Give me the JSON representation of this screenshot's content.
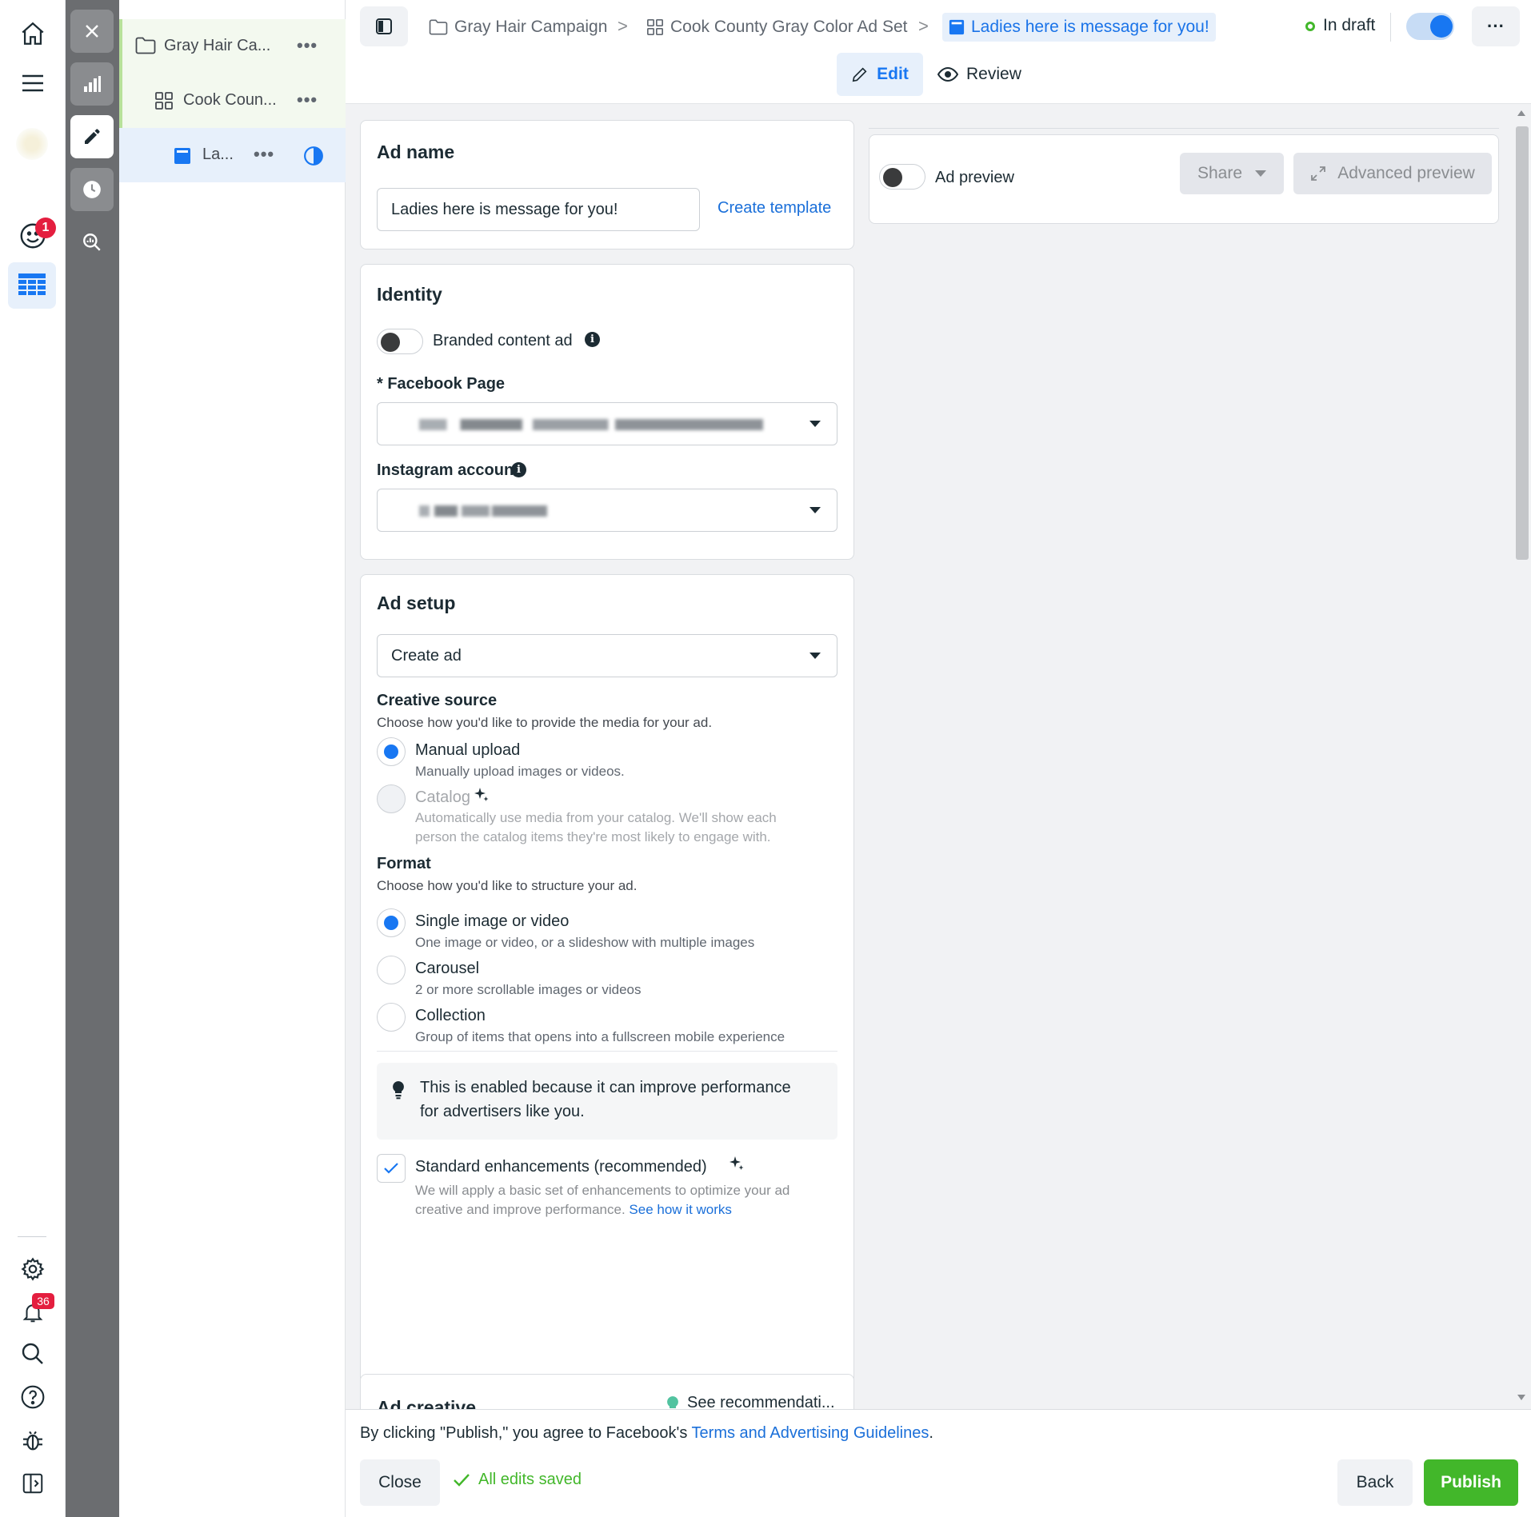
{
  "rail": {
    "notif_badge": "1",
    "alerts_badge": "36"
  },
  "tree": {
    "campaign": "Gray Hair Ca...",
    "adset": "Cook Coun...",
    "ad": "La...",
    "dots": "•••"
  },
  "header": {
    "crumbs": [
      "Gray Hair Campaign",
      "Cook County Gray Color Ad Set",
      "Ladies here is message for you!"
    ],
    "sep": ">",
    "status": "In draft",
    "more": "···",
    "tabs": {
      "edit": "Edit",
      "review": "Review"
    }
  },
  "adname": {
    "title": "Ad name",
    "value": "Ladies here is message for you!",
    "create_template": "Create template"
  },
  "identity": {
    "title": "Identity",
    "branded": "Branded content ad",
    "fb_page_label": "* Facebook Page",
    "ig_label": "Instagram account"
  },
  "setup": {
    "title": "Ad setup",
    "select_value": "Create ad",
    "creative_title": "Creative source",
    "creative_sub": "Choose how you'd like to provide the media for your ad.",
    "manual_label": "Manual upload",
    "manual_desc": "Manually upload images or videos.",
    "catalog_label": "Catalog",
    "catalog_desc1": "Automatically use media from your catalog. We'll show each",
    "catalog_desc2": "person the catalog items they're most likely to engage with.",
    "format_title": "Format",
    "format_sub": "Choose how you'd like to structure your ad.",
    "single_label": "Single image or video",
    "single_desc": "One image or video, or a slideshow with multiple images",
    "carousel_label": "Carousel",
    "carousel_desc": "2 or more scrollable images or videos",
    "collection_label": "Collection",
    "collection_desc": "Group of items that opens into a fullscreen mobile experience",
    "tip1": "This is enabled because it can improve performance",
    "tip2": "for advertisers like you.",
    "enh_label": "Standard enhancements (recommended)",
    "enh_desc1": "We will apply a basic set of enhancements to optimize your ad",
    "enh_desc2": "creative and improve performance.",
    "see_how": "See how it works"
  },
  "creative": {
    "title": "Ad creative",
    "recs": "See recommendati..."
  },
  "preview": {
    "label": "Ad preview",
    "share": "Share",
    "advanced": "Advanced preview"
  },
  "footer": {
    "agree": "By clicking \"Publish,\" you agree to Facebook's",
    "terms": "Terms and Advertising Guidelines",
    "period": ".",
    "close": "Close",
    "saved": "All edits saved",
    "back": "Back",
    "publish": "Publish"
  },
  "colors": {
    "accent": "#1877f2",
    "publish": "#42b72a",
    "status": "#42b72a"
  }
}
